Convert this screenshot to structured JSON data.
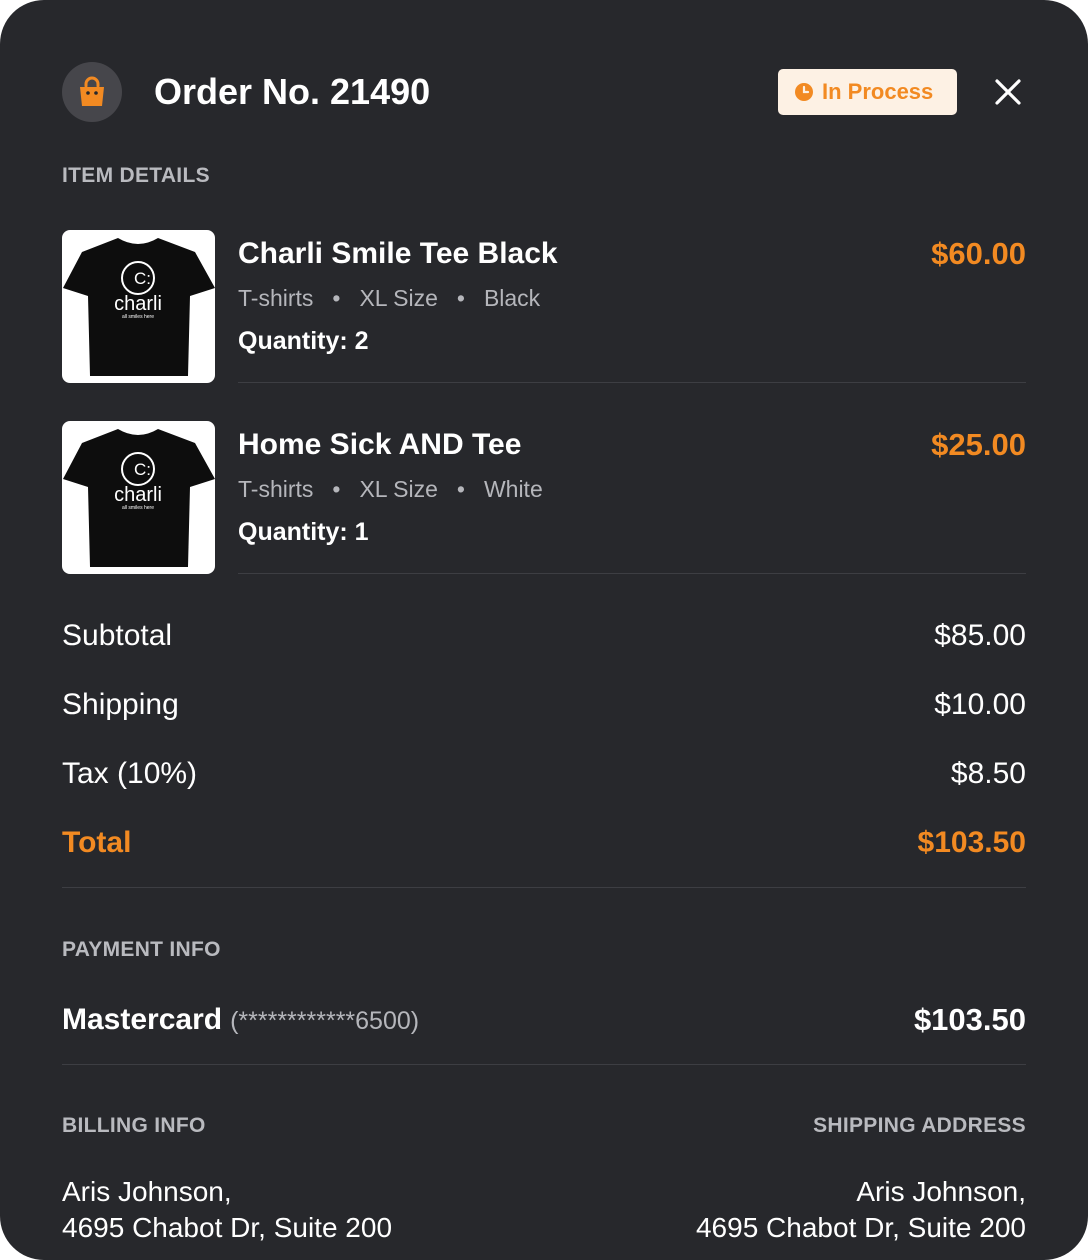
{
  "header": {
    "title": "Order No. 21490",
    "status_label": "In Process",
    "status_color": "#F28A22",
    "icon": "shopping-bag-icon",
    "close_icon": "close-icon"
  },
  "item_details": {
    "label": "ITEM DETAILS",
    "items": [
      {
        "name": "Charli Smile Tee Black",
        "category": "T-shirts",
        "size": "XL Size",
        "color": "Black",
        "quantity": "Quantity: 2",
        "price": "$60.00",
        "thumb_text": "charli",
        "thumb_tagline": "all smiles here"
      },
      {
        "name": "Home Sick AND Tee",
        "category": "T-shirts",
        "size": "XL Size",
        "color": "White",
        "quantity": "Quantity: 1",
        "price": "$25.00",
        "thumb_text": "charli",
        "thumb_tagline": "all smiles here"
      }
    ]
  },
  "summary": {
    "subtotal_label": "Subtotal",
    "subtotal_value": "$85.00",
    "shipping_label": "Shipping",
    "shipping_value": "$10.00",
    "tax_label": "Tax (10%)",
    "tax_value": "$8.50",
    "total_label": "Total",
    "total_value": "$103.50"
  },
  "payment": {
    "label": "PAYMENT INFO",
    "method": "Mastercard",
    "card_mask": "(************6500)",
    "amount": "$103.50"
  },
  "billing": {
    "label": "BILLING INFO",
    "name": "Aris Johnson,",
    "address_line": "4695 Chabot Dr, Suite 200"
  },
  "shipping_address": {
    "label": "SHIPPING ADDRESS",
    "name": "Aris Johnson,",
    "address_line": "4695 Chabot Dr, Suite 200"
  },
  "colors": {
    "accent": "#F28A22",
    "background": "#27282C",
    "badge_background": "#FDF1E4"
  }
}
